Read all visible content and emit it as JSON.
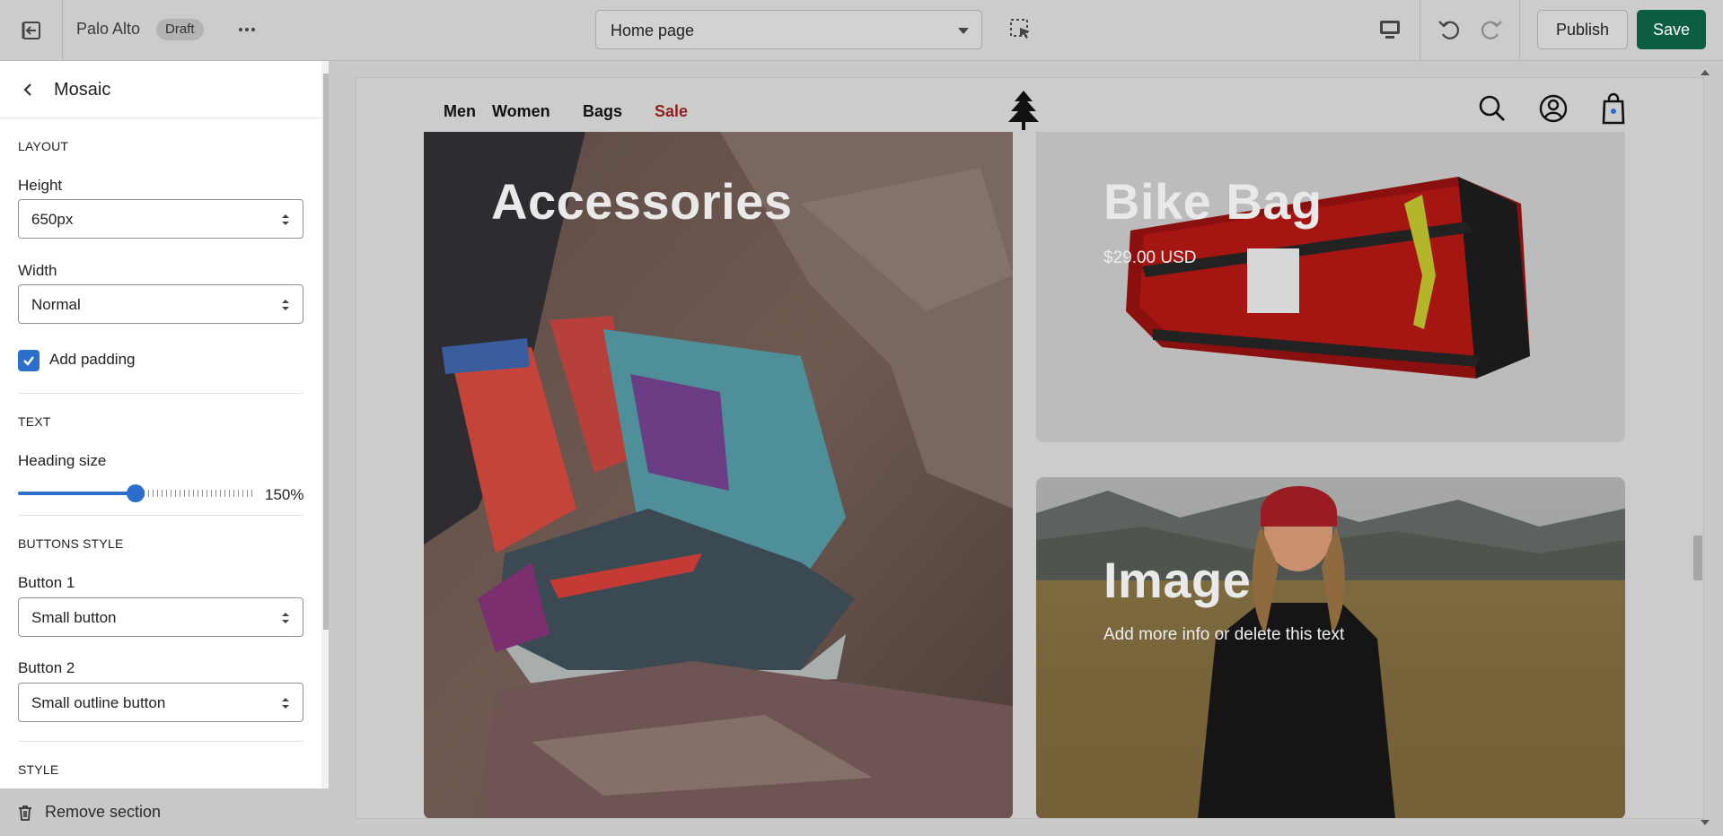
{
  "topbar": {
    "store_name": "Palo Alto",
    "status_badge": "Draft",
    "page_select": "Home page",
    "publish_label": "Publish",
    "save_label": "Save",
    "accent_color": "#0b5d44"
  },
  "sidebar": {
    "title": "Mosaic",
    "layout_heading": "LAYOUT",
    "height_label": "Height",
    "height_value": "650px",
    "width_label": "Width",
    "width_value": "Normal",
    "padding_label": "Add padding",
    "padding_checked": true,
    "text_heading": "TEXT",
    "heading_size_label": "Heading size",
    "heading_size_value": "150%",
    "heading_size_fraction": 0.5,
    "buttons_heading": "BUTTONS STYLE",
    "button1_label": "Button 1",
    "button1_value": "Small button",
    "button2_label": "Button 2",
    "button2_value": "Small outline button",
    "style_heading": "STYLE",
    "remove_label": "Remove section"
  },
  "preview": {
    "nav": [
      "Men",
      "Women",
      "Bags",
      "Sale"
    ],
    "sale_color": "#8f1e1e",
    "tiles": [
      {
        "heading": "Accessories"
      },
      {
        "heading": "Bike Bag",
        "price": "$29.00 USD"
      },
      {
        "heading": "Image",
        "text": "Add more info or delete this text"
      }
    ]
  }
}
